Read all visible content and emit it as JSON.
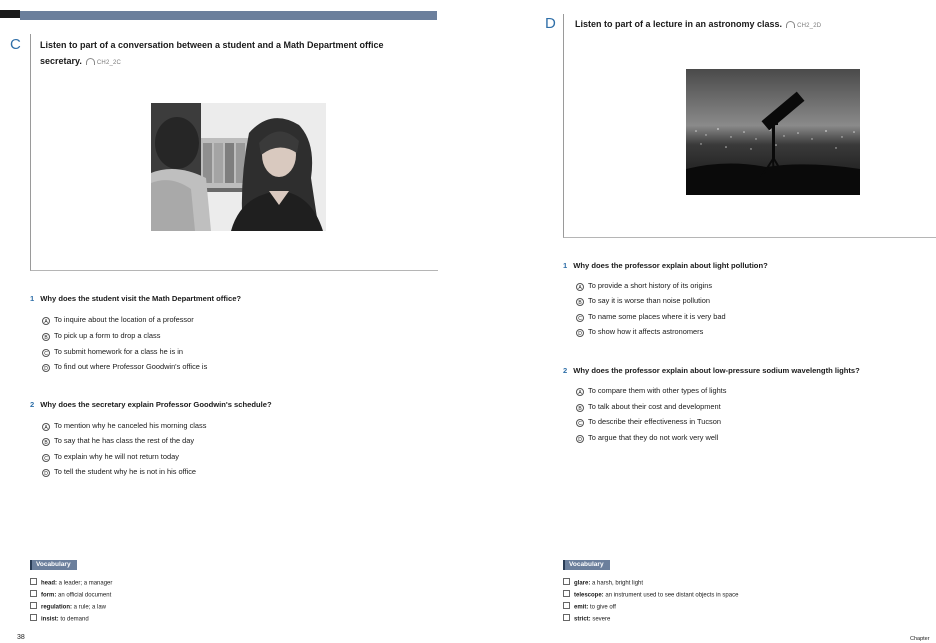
{
  "left": {
    "letter": "C",
    "heading_line1": "Listen to part of a conversation between a student and a Math Department office",
    "heading_line2": "secretary.",
    "track": "CH2_2C",
    "questions": [
      {
        "num": "1",
        "text": "Why does the student visit the Math Department office?",
        "options": [
          {
            "letter": "A",
            "text": "To inquire about the location of a professor"
          },
          {
            "letter": "B",
            "text": "To pick up a form to drop a class"
          },
          {
            "letter": "C",
            "text": "To submit homework for a class he is in"
          },
          {
            "letter": "D",
            "text": "To find out where Professor Goodwin's office is"
          }
        ]
      },
      {
        "num": "2",
        "text": "Why does the secretary explain Professor Goodwin's schedule?",
        "options": [
          {
            "letter": "A",
            "text": "To mention why he canceled his morning class"
          },
          {
            "letter": "B",
            "text": "To say that he has class the rest of the day"
          },
          {
            "letter": "C",
            "text": "To explain why he will not return today"
          },
          {
            "letter": "D",
            "text": "To tell the student why he is not in his office"
          }
        ]
      }
    ],
    "vocab_label": "Vocabulary",
    "vocab": [
      {
        "term": "head:",
        "def": " a leader; a manager"
      },
      {
        "term": "form:",
        "def": " an official document"
      },
      {
        "term": "regulation:",
        "def": " a rule; a law"
      },
      {
        "term": "insist:",
        "def": " to demand"
      }
    ],
    "page_num": "38"
  },
  "right": {
    "letter": "D",
    "heading": "Listen to part of a lecture in an astronomy class.",
    "track": "CH2_2D",
    "questions": [
      {
        "num": "1",
        "text": "Why does the professor explain about light pollution?",
        "options": [
          {
            "letter": "A",
            "text": "To provide a short history of its origins"
          },
          {
            "letter": "B",
            "text": "To say it is worse than noise pollution"
          },
          {
            "letter": "C",
            "text": "To name some places where it is very bad"
          },
          {
            "letter": "D",
            "text": "To show how it affects astronomers"
          }
        ]
      },
      {
        "num": "2",
        "text": "Why does the professor explain about low-pressure sodium wavelength lights?",
        "options": [
          {
            "letter": "A",
            "text": "To compare them with other types of lights"
          },
          {
            "letter": "B",
            "text": "To talk about their cost and development"
          },
          {
            "letter": "C",
            "text": "To describe their effectiveness in Tucson"
          },
          {
            "letter": "D",
            "text": "To argue that they do not work very well"
          }
        ]
      }
    ],
    "vocab_label": "Vocabulary",
    "vocab": [
      {
        "term": "glare:",
        "def": " a harsh, bright light"
      },
      {
        "term": "telescope:",
        "def": " an instrument used to see distant objects in space"
      },
      {
        "term": "emit:",
        "def": " to give off"
      },
      {
        "term": "strict:",
        "def": " severe"
      }
    ],
    "page_num": "Chapter"
  }
}
